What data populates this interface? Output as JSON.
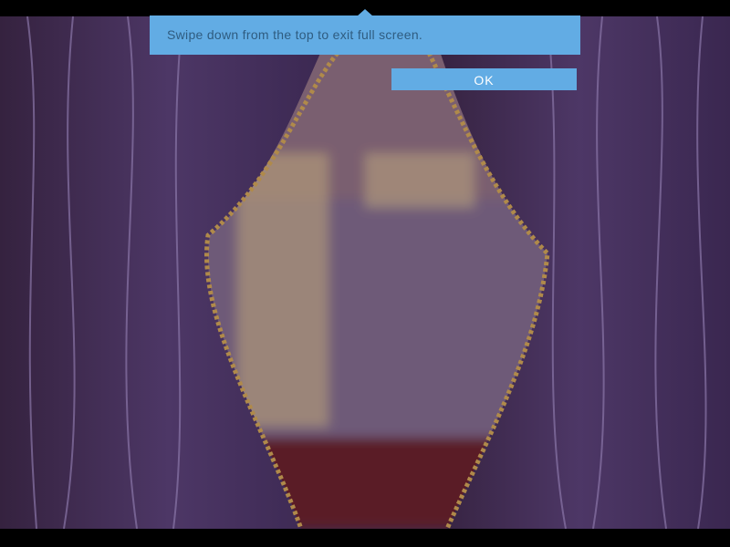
{
  "fullscreen_notice": {
    "message": "Swipe down from the top to exit full screen.",
    "ok_label": "OK"
  },
  "colors": {
    "toast": "#62ace4",
    "curtain": "#4a3560",
    "floor": "#5a1a28"
  }
}
